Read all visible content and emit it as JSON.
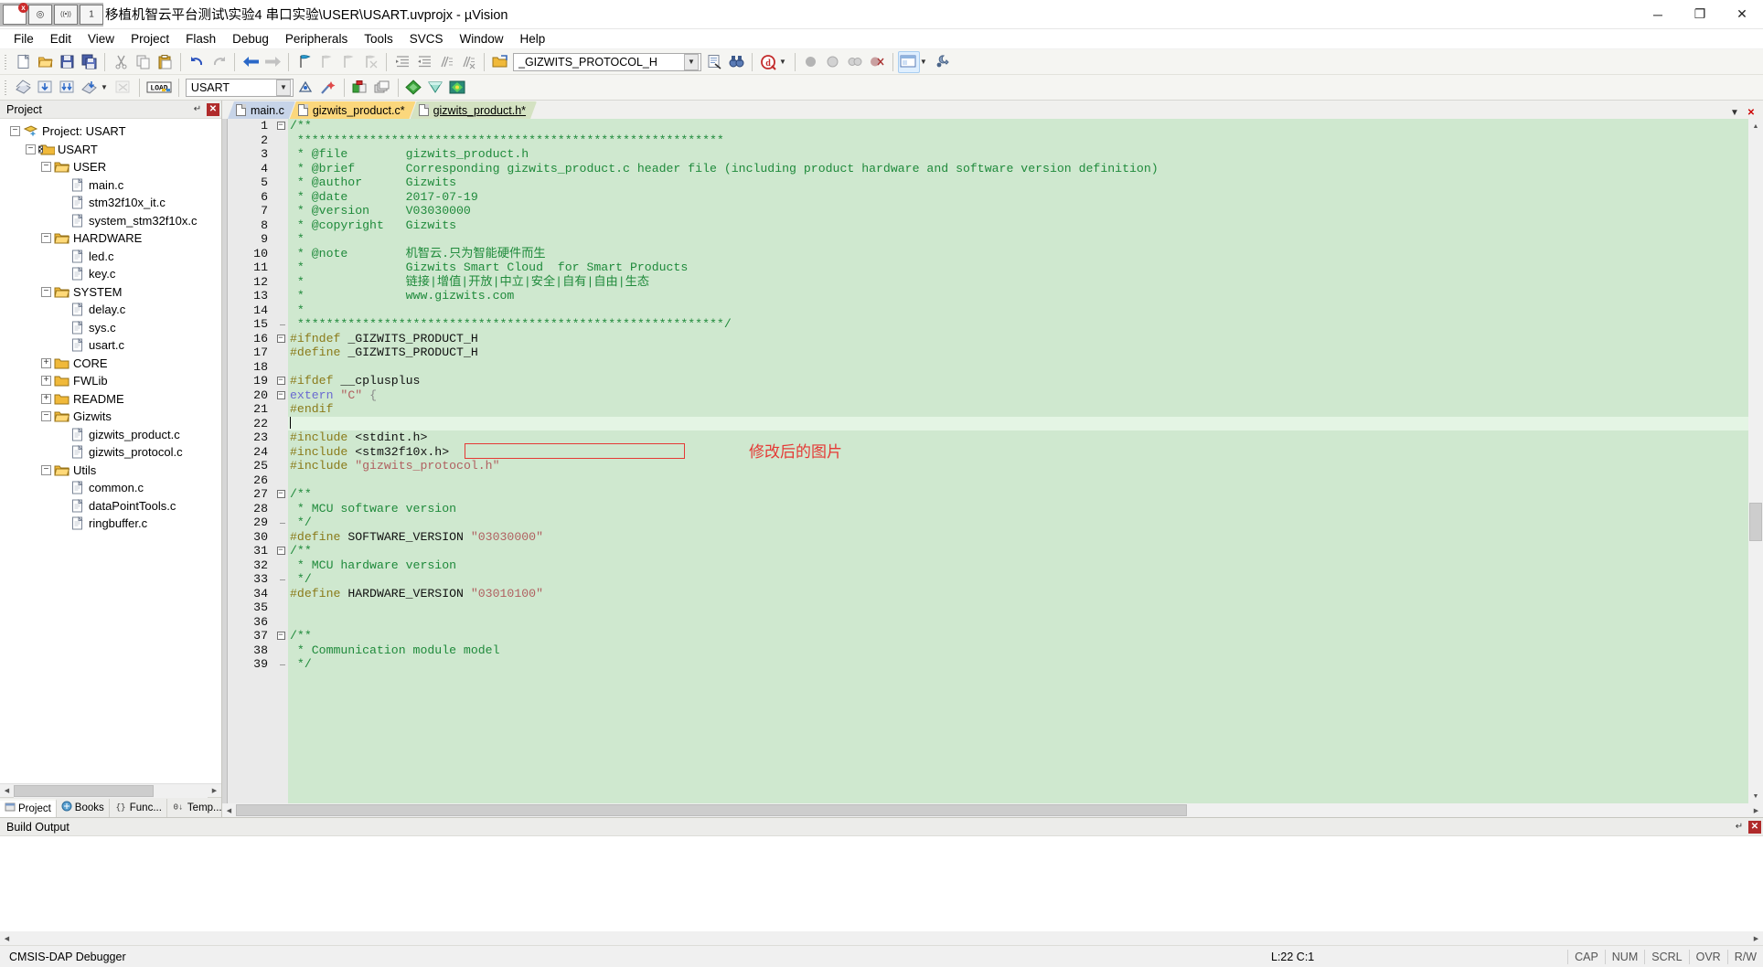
{
  "window": {
    "title": "移植机智云平台测试\\实验4 串口实验\\USER\\USART.uvprojx - µVision",
    "title_prefix_hidden": "e\\",
    "minimize": "─",
    "maximize": "❐",
    "close": "✕"
  },
  "overlay_icons": [
    {
      "name": "capture-region-icon",
      "glyph": "▣"
    },
    {
      "name": "camera-icon",
      "glyph": "◎"
    },
    {
      "name": "wifi-icon",
      "glyph": "((•))"
    },
    {
      "name": "counter-icon",
      "glyph": "1"
    }
  ],
  "menu": {
    "items": [
      {
        "label": "File"
      },
      {
        "label": "Edit"
      },
      {
        "label": "View"
      },
      {
        "label": "Project"
      },
      {
        "label": "Flash"
      },
      {
        "label": "Debug"
      },
      {
        "label": "Peripherals"
      },
      {
        "label": "Tools"
      },
      {
        "label": "SVCS"
      },
      {
        "label": "Window"
      },
      {
        "label": "Help"
      }
    ]
  },
  "toolbar_main": {
    "buttons": [
      {
        "name": "new-file-icon",
        "title": "New"
      },
      {
        "name": "open-file-icon",
        "title": "Open"
      },
      {
        "name": "save-icon",
        "title": "Save"
      },
      {
        "name": "save-all-icon",
        "title": "Save All"
      },
      {
        "name": "cut-icon",
        "title": "Cut"
      },
      {
        "name": "copy-icon",
        "title": "Copy"
      },
      {
        "name": "paste-icon",
        "title": "Paste"
      },
      {
        "name": "undo-icon",
        "title": "Undo"
      },
      {
        "name": "redo-icon",
        "title": "Redo"
      },
      {
        "name": "navigate-back-icon",
        "title": "Back"
      },
      {
        "name": "navigate-forward-icon",
        "title": "Forward"
      },
      {
        "name": "bookmark-toggle-icon",
        "title": "Insert/Remove Bookmark"
      },
      {
        "name": "bookmark-prev-icon",
        "title": "Previous Bookmark"
      },
      {
        "name": "bookmark-next-icon",
        "title": "Next Bookmark"
      },
      {
        "name": "bookmark-clear-icon",
        "title": "Clear All Bookmarks"
      },
      {
        "name": "indent-right-icon",
        "title": "Indent"
      },
      {
        "name": "indent-left-icon",
        "title": "Outdent"
      },
      {
        "name": "comment-icon",
        "title": "Comment"
      },
      {
        "name": "uncomment-icon",
        "title": "Uncomment"
      },
      {
        "name": "open-in-editor-icon",
        "title": "Open File"
      }
    ],
    "symbol_combo_value": "_GIZWITS_PROTOCOL_H",
    "after_combo": [
      {
        "name": "find-in-files-icon",
        "title": "Find in Files"
      },
      {
        "name": "binoculars-icon",
        "title": "Find"
      },
      {
        "name": "debug-q-icon",
        "title": "Start/Stop Debug Session"
      },
      {
        "name": "breakpoint-icon",
        "title": "Insert/Remove Breakpoint"
      },
      {
        "name": "breakpoint-disable-icon",
        "title": "Enable/Disable Breakpoint"
      },
      {
        "name": "breakpoint-disable-all-icon",
        "title": "Disable All Breakpoints"
      },
      {
        "name": "breakpoint-kill-icon",
        "title": "Kill All Breakpoints"
      },
      {
        "name": "window-layout-icon",
        "title": "Configure Windows"
      },
      {
        "name": "settings-wrench-icon",
        "title": "Configuration Wizard"
      }
    ]
  },
  "toolbar_build": {
    "buttons": [
      {
        "name": "translate-icon",
        "title": "Translate"
      },
      {
        "name": "build-icon",
        "title": "Build"
      },
      {
        "name": "rebuild-icon",
        "title": "Rebuild"
      },
      {
        "name": "batch-build-icon",
        "title": "Batch Build"
      },
      {
        "name": "batch-build-dropdown-icon",
        "title": "Batch Build Options"
      },
      {
        "name": "stop-build-icon",
        "title": "Stop Build"
      },
      {
        "name": "download-icon",
        "title": "Download"
      }
    ],
    "target_combo_value": "USART",
    "after_combo": [
      {
        "name": "target-options-icon",
        "title": "Options for Target"
      },
      {
        "name": "magic-wand-icon",
        "title": "Options"
      },
      {
        "name": "manage-project-items-icon",
        "title": "Manage Project Items"
      },
      {
        "name": "multi-project-icon",
        "title": "Multi-Project"
      },
      {
        "name": "components-icon",
        "title": "Manage Run-Time Environment"
      },
      {
        "name": "pack-installer-icon",
        "title": "Pack Installer"
      },
      {
        "name": "select-software-packs-icon",
        "title": "Select Software Packs"
      }
    ]
  },
  "project_panel": {
    "title": "Project",
    "pin_glyph": "↵",
    "close_glyph": "✕",
    "tree": [
      {
        "depth": 0,
        "toggle": "-",
        "icon": "project-icon",
        "label": "Project: USART"
      },
      {
        "depth": 1,
        "toggle": "-",
        "icon": "target-icon",
        "label": "USART"
      },
      {
        "depth": 2,
        "toggle": "-",
        "icon": "folder-open-icon",
        "label": "USER"
      },
      {
        "depth": 3,
        "toggle": "",
        "icon": "c-file-icon",
        "label": "main.c"
      },
      {
        "depth": 3,
        "toggle": "",
        "icon": "c-file-icon",
        "label": "stm32f10x_it.c"
      },
      {
        "depth": 3,
        "toggle": "",
        "icon": "c-file-icon",
        "label": "system_stm32f10x.c"
      },
      {
        "depth": 2,
        "toggle": "-",
        "icon": "folder-open-icon",
        "label": "HARDWARE"
      },
      {
        "depth": 3,
        "toggle": "",
        "icon": "c-file-icon",
        "label": "led.c"
      },
      {
        "depth": 3,
        "toggle": "",
        "icon": "c-file-icon",
        "label": "key.c"
      },
      {
        "depth": 2,
        "toggle": "-",
        "icon": "folder-open-icon",
        "label": "SYSTEM"
      },
      {
        "depth": 3,
        "toggle": "",
        "icon": "c-file-icon",
        "label": "delay.c"
      },
      {
        "depth": 3,
        "toggle": "",
        "icon": "c-file-icon",
        "label": "sys.c"
      },
      {
        "depth": 3,
        "toggle": "",
        "icon": "c-file-icon",
        "label": "usart.c"
      },
      {
        "depth": 2,
        "toggle": "+",
        "icon": "folder-closed-icon",
        "label": "CORE"
      },
      {
        "depth": 2,
        "toggle": "+",
        "icon": "folder-closed-icon",
        "label": "FWLib"
      },
      {
        "depth": 2,
        "toggle": "+",
        "icon": "folder-closed-icon",
        "label": "README"
      },
      {
        "depth": 2,
        "toggle": "-",
        "icon": "folder-open-icon",
        "label": "Gizwits"
      },
      {
        "depth": 3,
        "toggle": "",
        "icon": "c-file-icon",
        "label": "gizwits_product.c"
      },
      {
        "depth": 3,
        "toggle": "",
        "icon": "c-file-icon",
        "label": "gizwits_protocol.c"
      },
      {
        "depth": 2,
        "toggle": "-",
        "icon": "folder-open-icon",
        "label": "Utils"
      },
      {
        "depth": 3,
        "toggle": "",
        "icon": "c-file-icon",
        "label": "common.c"
      },
      {
        "depth": 3,
        "toggle": "",
        "icon": "c-file-icon",
        "label": "dataPointTools.c"
      },
      {
        "depth": 3,
        "toggle": "",
        "icon": "c-file-icon",
        "label": "ringbuffer.c"
      }
    ],
    "footer_tabs": [
      {
        "label": "Project",
        "icon": "project-tab-icon",
        "active": true
      },
      {
        "label": "Books",
        "icon": "books-tab-icon",
        "active": false
      },
      {
        "label": "Func...",
        "icon": "functions-tab-icon",
        "active": false
      },
      {
        "label": "Temp...",
        "icon": "templates-tab-icon",
        "active": false
      }
    ]
  },
  "editor": {
    "tabs": [
      {
        "label": "main.c",
        "color": "blue",
        "active": false,
        "modified": false
      },
      {
        "label": "gizwits_product.c*",
        "color": "orange",
        "active": false,
        "modified": true
      },
      {
        "label": "gizwits_product.h*",
        "color": "green",
        "active": true,
        "modified": true
      }
    ],
    "tab_buttons": [
      {
        "name": "tab-list-down-icon",
        "glyph": "▼"
      },
      {
        "name": "tab-close-icon",
        "glyph": "✕"
      }
    ],
    "current_line": 22,
    "annotation": {
      "text": "修改后的图片",
      "color": "#e53935"
    },
    "highlight_box": {
      "line": 24,
      "color": "#e53935"
    },
    "lines": [
      {
        "n": 1,
        "fold": "-",
        "tokens": [
          {
            "t": "/**",
            "c": "com"
          }
        ]
      },
      {
        "n": 2,
        "fold": "|",
        "tokens": [
          {
            "t": " ***********************************************************",
            "c": "com"
          }
        ]
      },
      {
        "n": 3,
        "fold": "|",
        "tokens": [
          {
            "t": " * @file        gizwits_product.h",
            "c": "com"
          }
        ]
      },
      {
        "n": 4,
        "fold": "|",
        "tokens": [
          {
            "t": " * @brief       Corresponding gizwits_product.c header file (including product hardware and software version definition)",
            "c": "com"
          }
        ]
      },
      {
        "n": 5,
        "fold": "|",
        "tokens": [
          {
            "t": " * @author      Gizwits",
            "c": "com"
          }
        ]
      },
      {
        "n": 6,
        "fold": "|",
        "tokens": [
          {
            "t": " * @date        2017-07-19",
            "c": "com"
          }
        ]
      },
      {
        "n": 7,
        "fold": "|",
        "tokens": [
          {
            "t": " * @version     V03030000",
            "c": "com"
          }
        ]
      },
      {
        "n": 8,
        "fold": "|",
        "tokens": [
          {
            "t": " * @copyright   Gizwits",
            "c": "com"
          }
        ]
      },
      {
        "n": 9,
        "fold": "|",
        "tokens": [
          {
            "t": " *",
            "c": "com"
          }
        ]
      },
      {
        "n": 10,
        "fold": "|",
        "tokens": [
          {
            "t": " * @note        机智云.只为智能硬件而生",
            "c": "com"
          }
        ]
      },
      {
        "n": 11,
        "fold": "|",
        "tokens": [
          {
            "t": " *              Gizwits Smart Cloud  for Smart Products",
            "c": "com"
          }
        ]
      },
      {
        "n": 12,
        "fold": "|",
        "tokens": [
          {
            "t": " *              链接|增值|开放|中立|安全|自有|自由|生态",
            "c": "com"
          }
        ]
      },
      {
        "n": 13,
        "fold": "|",
        "tokens": [
          {
            "t": " *              www.gizwits.com",
            "c": "com"
          }
        ]
      },
      {
        "n": 14,
        "fold": "|",
        "tokens": [
          {
            "t": " *",
            "c": "com"
          }
        ]
      },
      {
        "n": 15,
        "fold": "L",
        "tokens": [
          {
            "t": " ***********************************************************/",
            "c": "com"
          }
        ]
      },
      {
        "n": 16,
        "fold": "-",
        "tokens": [
          {
            "t": "#ifndef",
            "c": "pre"
          },
          {
            "t": " _GIZWITS_PRODUCT_H",
            "c": "id"
          }
        ]
      },
      {
        "n": 17,
        "fold": "|",
        "tokens": [
          {
            "t": "#define",
            "c": "pre"
          },
          {
            "t": " _GIZWITS_PRODUCT_H",
            "c": "id"
          }
        ]
      },
      {
        "n": 18,
        "fold": "|",
        "tokens": [
          {
            "t": "",
            "c": "id"
          }
        ]
      },
      {
        "n": 19,
        "fold": "-",
        "tokens": [
          {
            "t": "#ifdef",
            "c": "pre"
          },
          {
            "t": " __cplusplus",
            "c": "id"
          }
        ]
      },
      {
        "n": 20,
        "fold": "-",
        "tokens": [
          {
            "t": "extern",
            "c": "kw"
          },
          {
            "t": " ",
            "c": "id"
          },
          {
            "t": "\"C\"",
            "c": "str"
          },
          {
            "t": " {",
            "c": "punc"
          }
        ]
      },
      {
        "n": 21,
        "fold": "|",
        "tokens": [
          {
            "t": "#endif",
            "c": "pre"
          }
        ]
      },
      {
        "n": 22,
        "fold": "|",
        "tokens": [
          {
            "t": "",
            "c": "id"
          }
        ]
      },
      {
        "n": 23,
        "fold": "",
        "tokens": [
          {
            "t": "#include",
            "c": "pre"
          },
          {
            "t": " <stdint.h>",
            "c": "id"
          }
        ]
      },
      {
        "n": 24,
        "fold": "",
        "tokens": [
          {
            "t": "#include",
            "c": "pre"
          },
          {
            "t": " <stm32f10x.h>",
            "c": "id"
          }
        ]
      },
      {
        "n": 25,
        "fold": "",
        "tokens": [
          {
            "t": "#include",
            "c": "pre"
          },
          {
            "t": " ",
            "c": "id"
          },
          {
            "t": "\"gizwits_protocol.h\"",
            "c": "str"
          }
        ]
      },
      {
        "n": 26,
        "fold": "",
        "tokens": [
          {
            "t": "",
            "c": "id"
          }
        ]
      },
      {
        "n": 27,
        "fold": "-",
        "tokens": [
          {
            "t": "/**",
            "c": "com"
          }
        ]
      },
      {
        "n": 28,
        "fold": "|",
        "tokens": [
          {
            "t": " * MCU software version",
            "c": "com"
          }
        ]
      },
      {
        "n": 29,
        "fold": "L",
        "tokens": [
          {
            "t": " */",
            "c": "com"
          }
        ]
      },
      {
        "n": 30,
        "fold": "",
        "tokens": [
          {
            "t": "#define",
            "c": "pre"
          },
          {
            "t": " SOFTWARE_VERSION ",
            "c": "id"
          },
          {
            "t": "\"03030000\"",
            "c": "str"
          }
        ]
      },
      {
        "n": 31,
        "fold": "-",
        "tokens": [
          {
            "t": "/**",
            "c": "com"
          }
        ]
      },
      {
        "n": 32,
        "fold": "|",
        "tokens": [
          {
            "t": " * MCU hardware version",
            "c": "com"
          }
        ]
      },
      {
        "n": 33,
        "fold": "L",
        "tokens": [
          {
            "t": " */",
            "c": "com"
          }
        ]
      },
      {
        "n": 34,
        "fold": "",
        "tokens": [
          {
            "t": "#define",
            "c": "pre"
          },
          {
            "t": " HARDWARE_VERSION ",
            "c": "id"
          },
          {
            "t": "\"03010100\"",
            "c": "str"
          }
        ]
      },
      {
        "n": 35,
        "fold": "",
        "tokens": [
          {
            "t": "",
            "c": "id"
          }
        ]
      },
      {
        "n": 36,
        "fold": "",
        "tokens": [
          {
            "t": "",
            "c": "id"
          }
        ]
      },
      {
        "n": 37,
        "fold": "-",
        "tokens": [
          {
            "t": "/**",
            "c": "com"
          }
        ]
      },
      {
        "n": 38,
        "fold": "|",
        "tokens": [
          {
            "t": " * Communication module model",
            "c": "com"
          }
        ]
      },
      {
        "n": 39,
        "fold": "L",
        "tokens": [
          {
            "t": " */",
            "c": "com"
          }
        ]
      }
    ]
  },
  "build_output": {
    "title": "Build Output",
    "pin_glyph": "↵",
    "close_glyph": "✕",
    "content": ""
  },
  "statusbar": {
    "debugger": "CMSIS-DAP Debugger",
    "position": "L:22 C:1",
    "indicators": [
      "CAP",
      "NUM",
      "SCRL",
      "OVR",
      "R/W"
    ]
  },
  "colors": {
    "code_bg": "#cfe8cf",
    "current_line_bg": "#e4f5e4",
    "comment": "#1f8a3b",
    "preprocessor": "#8a7a19",
    "keyword": "#6a6ad0",
    "string": "#b06060",
    "annotation": "#e53935",
    "tab_active": "#d4e2c2",
    "tab_modified": "#fbd77c",
    "tab_other": "#c7d4e8"
  }
}
